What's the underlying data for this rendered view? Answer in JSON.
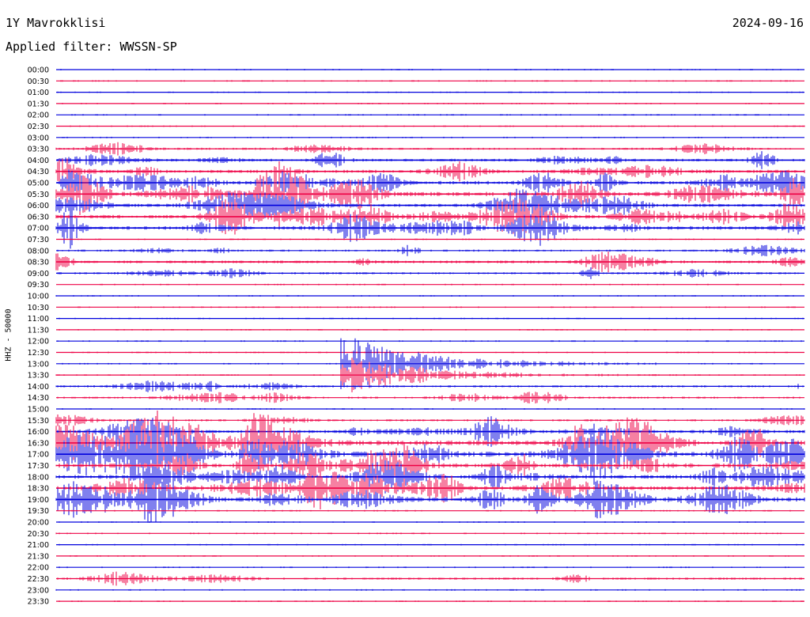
{
  "header": {
    "station": "1Y Mavrokklisi",
    "date": "2024-09-16",
    "filter": "Applied filter: WWSSN-SP"
  },
  "axis": {
    "channel_label": "HHZ - 50000"
  },
  "colors": {
    "odd_rows": "#0000dd",
    "even_rows": "#ee0044"
  },
  "chart_data": {
    "type": "line",
    "title": "1Y Mavrokklisi",
    "subtitle": "Applied filter: WWSSN-SP",
    "ylabel": "HHZ - 50000",
    "row_labels": [
      "00:00",
      "00:30",
      "01:00",
      "01:30",
      "02:00",
      "02:30",
      "03:00",
      "03:30",
      "04:00",
      "04:30",
      "05:00",
      "05:30",
      "06:00",
      "06:30",
      "07:00",
      "07:30",
      "08:00",
      "08:30",
      "09:00",
      "09:30",
      "10:00",
      "10:30",
      "11:00",
      "11:30",
      "12:00",
      "12:30",
      "13:00",
      "13:30",
      "14:00",
      "14:30",
      "15:00",
      "15:30",
      "16:00",
      "16:30",
      "17:00",
      "17:30",
      "18:00",
      "18:30",
      "19:00",
      "19:30",
      "20:00",
      "20:30",
      "21:00",
      "21:30",
      "22:00",
      "22:30",
      "23:00",
      "23:30"
    ],
    "activity": [
      1,
      1,
      1,
      1,
      1,
      1,
      1,
      2,
      3,
      4,
      5,
      6,
      4,
      5,
      5,
      1,
      2,
      3,
      2,
      1,
      1,
      1,
      1,
      1,
      1,
      1,
      1,
      1,
      2,
      2,
      1,
      2,
      4,
      7,
      8,
      6,
      5,
      5,
      6,
      1,
      1,
      1,
      1,
      1,
      1,
      2,
      1,
      1
    ],
    "event": {
      "start_row": "13:00",
      "duration_minutes": 14
    }
  }
}
